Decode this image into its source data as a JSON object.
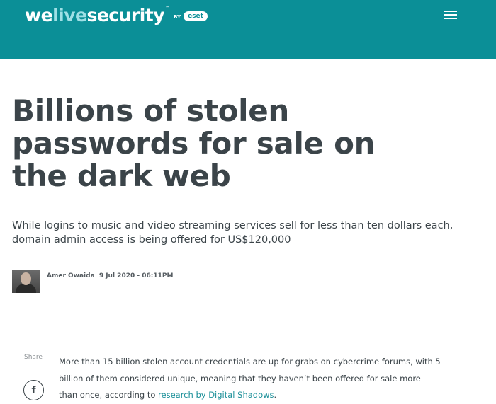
{
  "header": {
    "logo": {
      "part1": "we",
      "part2": "live",
      "part3": "security",
      "tm": "™",
      "by": "BY",
      "brand": "eset"
    },
    "menu_icon": "hamburger-menu-icon",
    "bg_color": "#0b8f97"
  },
  "article": {
    "title": "Billions of stolen passwords for sale on the dark web",
    "subtitle": "While logins to music and video streaming services sell for less than ten dollars each, domain admin access is being offered for US$120,000",
    "author": "Amer Owaida",
    "date": "9 Jul 2020 - 06:11PM",
    "share_label": "Share",
    "share_icon": "facebook-icon",
    "share_glyph": "f",
    "body": {
      "text_before_link": "More than 15 billion stolen account credentials are up for grabs on cybercrime forums, with 5 billion of them considered unique, meaning that they haven’t been offered for sale more than once, according to ",
      "link_text": "research by Digital Shadows",
      "text_after_link": "."
    }
  },
  "colors": {
    "accent": "#0b8f97",
    "link": "#1a8f98",
    "text": "#3b4449"
  }
}
